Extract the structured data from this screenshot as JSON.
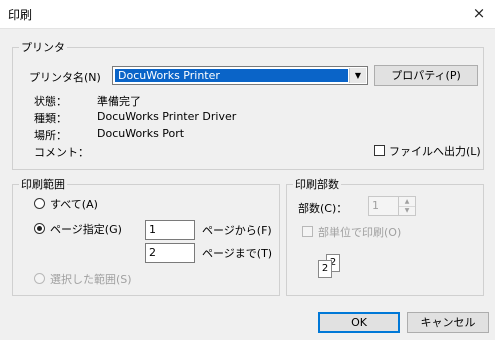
{
  "window": {
    "title": "印刷",
    "close_glyph": "×"
  },
  "printer": {
    "legend": "プリンタ",
    "name_label": "プリンタ名(N)",
    "selected_printer": "DocuWorks Printer",
    "properties_button": "プロパティ(P)",
    "status_label": "状態：",
    "status_value": "準備完了",
    "type_label": "種類：",
    "type_value": "DocuWorks Printer Driver",
    "location_label": "場所：",
    "location_value": "DocuWorks Port",
    "comment_label": "コメント：",
    "print_to_file_label": "ファイルへ出力(L)",
    "print_to_file_checked": false
  },
  "print_range": {
    "legend": "印刷範囲",
    "all_label": "すべて(A)",
    "pages_label": "ページ指定(G)",
    "selected_option": "pages",
    "from_value": "1",
    "from_label": "ページから(F)",
    "to_value": "2",
    "to_label": "ページまで(T)",
    "selection_label": "選択した範囲(S)"
  },
  "copies": {
    "legend": "印刷部数",
    "count_label": "部数(C)：",
    "count_value": "1",
    "collate_label": "部単位で印刷(O)",
    "collate_checked": false,
    "collate_icon_pages": [
      "2",
      "2"
    ]
  },
  "buttons": {
    "ok": "OK",
    "cancel": "キャンセル"
  },
  "colors": {
    "selection": "#0a64c8",
    "default_border": "#0078d7",
    "disabled_text": "#a0a0a0"
  }
}
